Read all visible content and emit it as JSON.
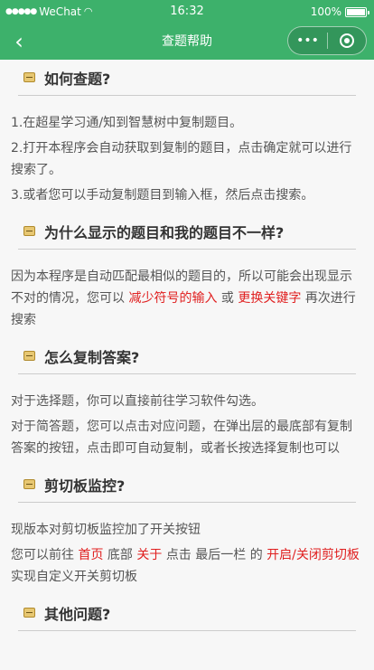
{
  "status": {
    "carrier": "WeChat",
    "time": "16:32",
    "battery": "100%"
  },
  "nav": {
    "title": "查题帮助",
    "more_label": "•••"
  },
  "sections": [
    {
      "title": "如何查题?",
      "lines": [
        "1.在超星学习通/知到智慧树中复制题目。",
        "2.打开本程序会自动获取到复制的题目，点击确定就可以进行搜索了。",
        "3.或者您可以手动复制题目到输入框，然后点击搜索。"
      ]
    },
    {
      "title": "为什么显示的题目和我的题目不一样?",
      "p1_a": "因为本程序是自动匹配最相似的题目的，所以可能会出现显示不对的情况，您可以",
      "p1_red1": "减少符号的输入",
      "p1_b": "或",
      "p1_red2": "更换关键字",
      "p1_c": "再次进行搜索"
    },
    {
      "title": "怎么复制答案?",
      "lines": [
        "对于选择题，你可以直接前往学习软件勾选。",
        "对于简答题，您可以点击对应问题，在弹出层的最底部有复制答案的按钮，点击即可自动复制，或者长按选择复制也可以"
      ]
    },
    {
      "title": "剪切板监控?",
      "line1": "现版本对剪切板监控加了开关按钮",
      "p2_a": "您可以前往",
      "p2_red1": "首页",
      "p2_b": "底部",
      "p2_red2": "关于",
      "p2_c": "点击 最后一栏 的",
      "p2_red3": "开启/关闭剪切板",
      "p2_d": "实现自定义开关剪切板"
    },
    {
      "title": "其他问题?"
    }
  ],
  "colors": {
    "header": "#3db16b",
    "highlight": "#e02020"
  }
}
